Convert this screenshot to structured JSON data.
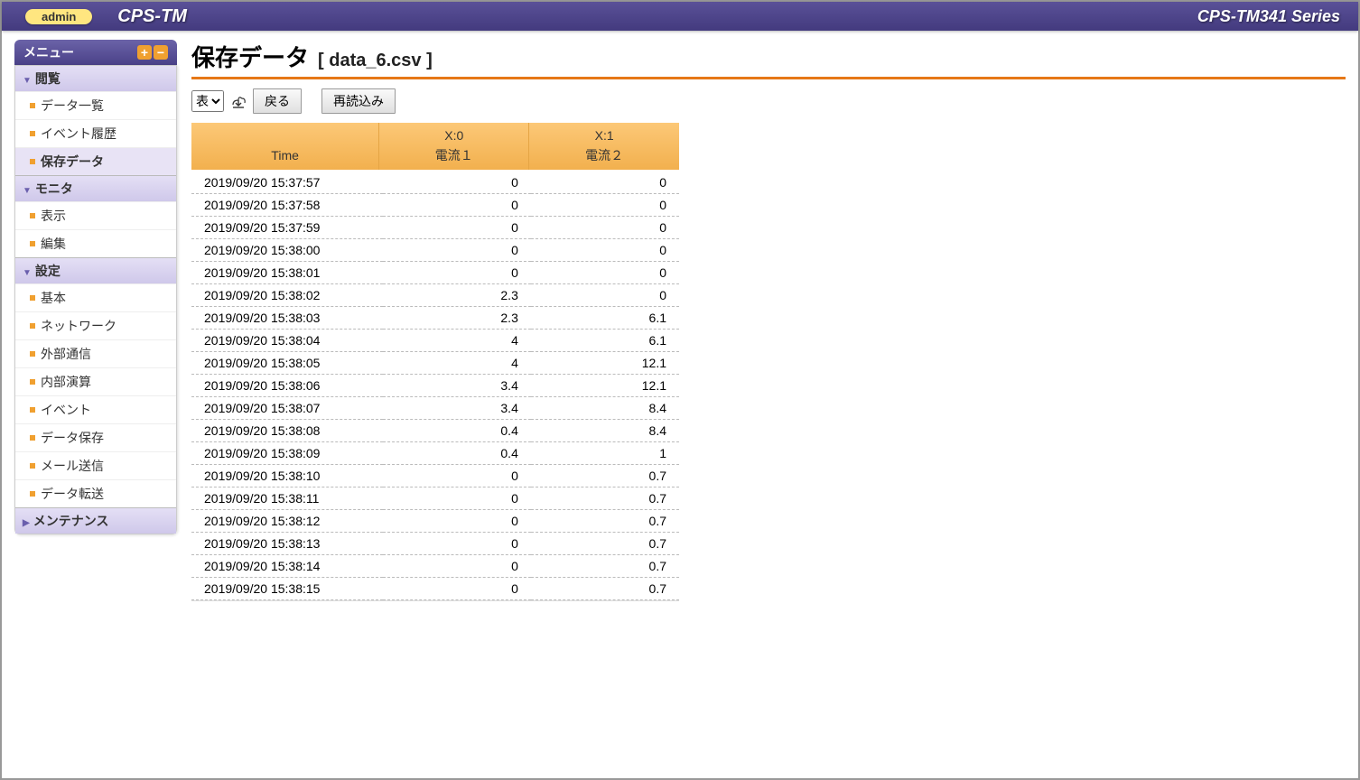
{
  "header": {
    "admin_label": "admin",
    "brand": "CPS-TM",
    "series": "CPS-TM341 Series"
  },
  "sidebar": {
    "menu_title": "メニュー",
    "groups": [
      {
        "label": "閲覧",
        "collapsed": false,
        "items": [
          {
            "label": "データ一覧",
            "active": false
          },
          {
            "label": "イベント履歴",
            "active": false
          },
          {
            "label": "保存データ",
            "active": true
          }
        ]
      },
      {
        "label": "モニタ",
        "collapsed": false,
        "items": [
          {
            "label": "表示",
            "active": false
          },
          {
            "label": "編集",
            "active": false
          }
        ]
      },
      {
        "label": "設定",
        "collapsed": false,
        "items": [
          {
            "label": "基本",
            "active": false
          },
          {
            "label": "ネットワーク",
            "active": false
          },
          {
            "label": "外部通信",
            "active": false
          },
          {
            "label": "内部演算",
            "active": false
          },
          {
            "label": "イベント",
            "active": false
          },
          {
            "label": "データ保存",
            "active": false
          },
          {
            "label": "メール送信",
            "active": false
          },
          {
            "label": "データ転送",
            "active": false
          }
        ]
      },
      {
        "label": "メンテナンス",
        "collapsed": true,
        "items": []
      }
    ]
  },
  "page": {
    "title": "保存データ",
    "subtitle": "[ data_6.csv ]"
  },
  "toolbar": {
    "view_select": "表",
    "back_label": "戻る",
    "reload_label": "再読込み"
  },
  "table": {
    "headers": [
      {
        "top": "",
        "bottom": "Time"
      },
      {
        "top": "X:0",
        "bottom": "電流１"
      },
      {
        "top": "X:1",
        "bottom": "電流２"
      }
    ],
    "rows": [
      {
        "time": "2019/09/20 15:37:57",
        "v0": "0",
        "v1": "0"
      },
      {
        "time": "2019/09/20 15:37:58",
        "v0": "0",
        "v1": "0"
      },
      {
        "time": "2019/09/20 15:37:59",
        "v0": "0",
        "v1": "0"
      },
      {
        "time": "2019/09/20 15:38:00",
        "v0": "0",
        "v1": "0"
      },
      {
        "time": "2019/09/20 15:38:01",
        "v0": "0",
        "v1": "0"
      },
      {
        "time": "2019/09/20 15:38:02",
        "v0": "2.3",
        "v1": "0"
      },
      {
        "time": "2019/09/20 15:38:03",
        "v0": "2.3",
        "v1": "6.1"
      },
      {
        "time": "2019/09/20 15:38:04",
        "v0": "4",
        "v1": "6.1"
      },
      {
        "time": "2019/09/20 15:38:05",
        "v0": "4",
        "v1": "12.1"
      },
      {
        "time": "2019/09/20 15:38:06",
        "v0": "3.4",
        "v1": "12.1"
      },
      {
        "time": "2019/09/20 15:38:07",
        "v0": "3.4",
        "v1": "8.4"
      },
      {
        "time": "2019/09/20 15:38:08",
        "v0": "0.4",
        "v1": "8.4"
      },
      {
        "time": "2019/09/20 15:38:09",
        "v0": "0.4",
        "v1": "1"
      },
      {
        "time": "2019/09/20 15:38:10",
        "v0": "0",
        "v1": "0.7"
      },
      {
        "time": "2019/09/20 15:38:11",
        "v0": "0",
        "v1": "0.7"
      },
      {
        "time": "2019/09/20 15:38:12",
        "v0": "0",
        "v1": "0.7"
      },
      {
        "time": "2019/09/20 15:38:13",
        "v0": "0",
        "v1": "0.7"
      },
      {
        "time": "2019/09/20 15:38:14",
        "v0": "0",
        "v1": "0.7"
      },
      {
        "time": "2019/09/20 15:38:15",
        "v0": "0",
        "v1": "0.7"
      }
    ]
  }
}
